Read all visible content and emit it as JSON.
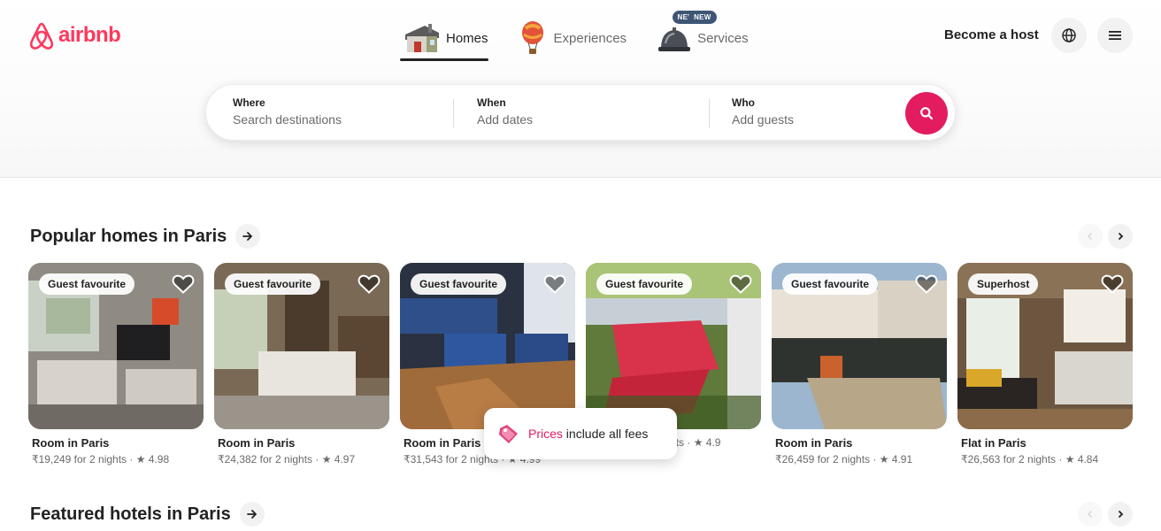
{
  "brand": {
    "name": "airbnb",
    "color": "#ff385c"
  },
  "nav": {
    "tabs": [
      {
        "label": "Homes",
        "icon": "house-icon",
        "active": true
      },
      {
        "label": "Experiences",
        "icon": "hot-air-balloon-icon",
        "badge": "NEW"
      },
      {
        "label": "Services",
        "icon": "service-bell-icon",
        "badge": "NEW"
      }
    ],
    "host_label": "Become a host",
    "globe_icon": "globe-icon",
    "menu_icon": "menu-icon"
  },
  "search": {
    "where": {
      "label": "Where",
      "placeholder": "Search destinations"
    },
    "when": {
      "label": "When",
      "placeholder": "Add dates"
    },
    "who": {
      "label": "Who",
      "placeholder": "Add guests"
    },
    "button_icon": "search-icon",
    "button_color": "#e31c5f"
  },
  "sections": {
    "popular": {
      "title": "Popular homes in Paris"
    },
    "featured": {
      "title": "Featured hotels in Paris"
    }
  },
  "listings": [
    {
      "badge": "Guest favourite",
      "title": "Room in Paris",
      "meta": "₹19,249 for 2 nights · ★ 4.98"
    },
    {
      "badge": "Guest favourite",
      "title": "Room in Paris",
      "meta": "₹24,382 for 2 nights · ★ 4.97"
    },
    {
      "badge": "Guest favourite",
      "title": "Room in Paris",
      "meta": "₹31,543 for 2 nights · ★ 4.99"
    },
    {
      "badge": "Guest favourite",
      "title": "",
      "meta": "₹30,975 for 2 nights · ★ 4.9"
    },
    {
      "badge": "Guest favourite",
      "title": "Room in Paris",
      "meta": "₹26,459 for 2 nights · ★ 4.91"
    },
    {
      "badge": "Superhost",
      "title": "Flat in Paris",
      "meta": "₹26,563 for 2 nights · ★ 4.84"
    }
  ],
  "toast": {
    "highlight": "Prices",
    "rest": " include all fees",
    "icon": "price-tag-icon"
  }
}
